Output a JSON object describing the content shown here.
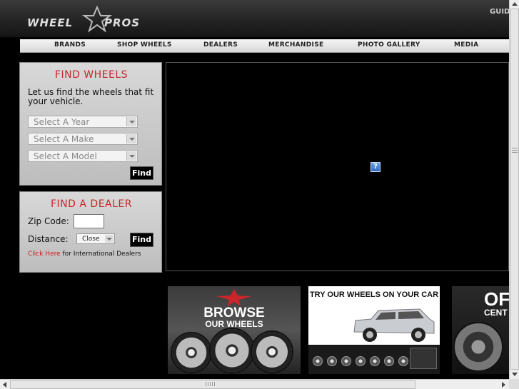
{
  "header": {
    "logo_left": "WHEEL",
    "logo_right": "PROS",
    "guide_link": "GUID"
  },
  "nav": {
    "items": [
      "BRANDS",
      "SHOP WHEELS",
      "DEALERS",
      "MERCHANDISE",
      "PHOTO GALLERY",
      "MEDIA"
    ]
  },
  "find_wheels": {
    "title": "FIND WHEELS",
    "intro": "Let us find the wheels that fit your vehicle.",
    "year_placeholder": "Select A Year",
    "make_placeholder": "Select A Make",
    "model_placeholder": "Select A Model",
    "find_label": "Find"
  },
  "find_dealer": {
    "title": "FIND A DEALER",
    "zip_label": "Zip Code:",
    "zip_value": "",
    "distance_label": "Distance:",
    "distance_value": "Close",
    "find_label": "Find",
    "click_here": "Click Here",
    "international_text": "for International Dealers"
  },
  "flash": {
    "plugin_glyph": "?"
  },
  "promos": {
    "browse_line1": "BROWSE",
    "browse_line2": "OUR WHEELS",
    "try_title": "TRY OUR WHEELS ON YOUR CAR",
    "off_title": "OF",
    "off_sub": "CENT"
  },
  "colors": {
    "accent_red": "#c8262a",
    "link_red": "#d21a1a"
  }
}
